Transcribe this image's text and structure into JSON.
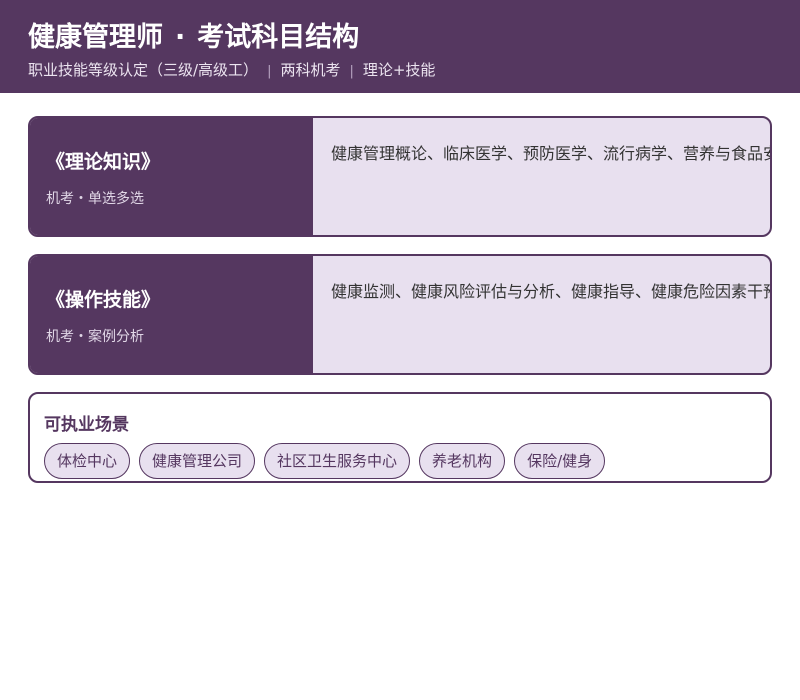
{
  "header": {
    "title_main": "健康管理师",
    "title_dot": "·",
    "title_sub": "考试科目结构",
    "subtitle": [
      "职业技能等级认定（三级/高级工）",
      "两科机考",
      "理论+技能"
    ],
    "separator": "|"
  },
  "subjects": [
    {
      "name": "《理论知识》",
      "mode": "机考・单选多选",
      "content": "健康管理概论、临床医学、预防医学、流行病学、营养与食品安全"
    },
    {
      "name": "《操作技能》",
      "mode": "机考・案例分析",
      "content": "健康监测、健康风险评估与分析、健康指导、健康危险因素干预"
    }
  ],
  "scenarios": {
    "title": "可执业场景",
    "tags": [
      "体检中心",
      "健康管理公司",
      "社区卫生服务中心",
      "养老机构",
      "保险/健身"
    ]
  },
  "colors": {
    "primary": "#553760",
    "light": "#e8e0ef"
  }
}
